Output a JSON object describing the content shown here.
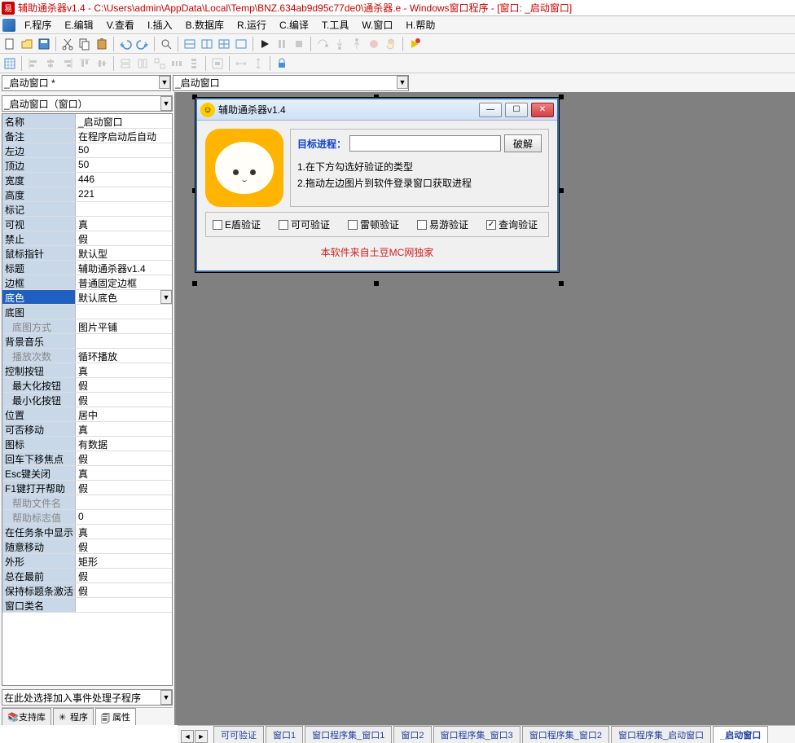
{
  "title": "辅助通杀器v1.4 - C:\\Users\\admin\\AppData\\Local\\Temp\\BNZ.634ab9d95c77de0\\通杀器.e - Windows窗口程序 - [窗口: _启动窗口]",
  "menu": {
    "program": "F.程序",
    "edit": "E.编辑",
    "view": "V.查看",
    "insert": "I.插入",
    "database": "B.数据库",
    "run": "R.运行",
    "compile": "C.编译",
    "tools": "T.工具",
    "window": "W.窗口",
    "help": "H.帮助"
  },
  "combo1": "_启动窗口 *",
  "combo2": "_启动窗口",
  "prop_combo": "_启动窗口（窗口）",
  "event_combo": "在此处选择加入事件处理子程序",
  "props": [
    {
      "k": "名称",
      "v": "_启动窗口"
    },
    {
      "k": "备注",
      "v": "在程序启动后自动"
    },
    {
      "k": "左边",
      "v": "50"
    },
    {
      "k": "顶边",
      "v": "50"
    },
    {
      "k": "宽度",
      "v": "446"
    },
    {
      "k": "高度",
      "v": "221"
    },
    {
      "k": "标记",
      "v": ""
    },
    {
      "k": "可视",
      "v": "真"
    },
    {
      "k": "禁止",
      "v": "假"
    },
    {
      "k": "鼠标指针",
      "v": "默认型"
    },
    {
      "k": "标题",
      "v": "辅助通杀器v1.4"
    },
    {
      "k": "边框",
      "v": "普通固定边框"
    },
    {
      "k": "底色",
      "v": "默认底色",
      "selected": true
    },
    {
      "k": "底图",
      "v": ""
    },
    {
      "k": "底图方式",
      "v": "图片平铺",
      "dim": true,
      "indent": true
    },
    {
      "k": "背景音乐",
      "v": ""
    },
    {
      "k": "播放次数",
      "v": "循环播放",
      "dim": true,
      "indent": true
    },
    {
      "k": "控制按钮",
      "v": "真"
    },
    {
      "k": "最大化按钮",
      "v": "假",
      "indent": true
    },
    {
      "k": "最小化按钮",
      "v": "假",
      "indent": true
    },
    {
      "k": "位置",
      "v": "居中"
    },
    {
      "k": "可否移动",
      "v": "真"
    },
    {
      "k": "图标",
      "v": "有数据"
    },
    {
      "k": "回车下移焦点",
      "v": "假"
    },
    {
      "k": "Esc键关闭",
      "v": "真"
    },
    {
      "k": "F1键打开帮助",
      "v": "假"
    },
    {
      "k": "帮助文件名",
      "v": "",
      "dim": true,
      "indent": true
    },
    {
      "k": "帮助标志值",
      "v": "0",
      "dim": true,
      "indent": true
    },
    {
      "k": "在任务条中显示",
      "v": "真"
    },
    {
      "k": "随意移动",
      "v": "假"
    },
    {
      "k": "外形",
      "v": "矩形"
    },
    {
      "k": "总在最前",
      "v": "假"
    },
    {
      "k": "保持标题条激活",
      "v": "假"
    },
    {
      "k": "窗口类名",
      "v": ""
    }
  ],
  "lefttabs": {
    "support": "支持库",
    "program": "程序",
    "property": "属性"
  },
  "designer": {
    "title": "辅助通杀器v1.4",
    "target_label": "目标进程：",
    "crack": "破解",
    "instr1": "1.在下方勾选好验证的类型",
    "instr2": "2.拖动左边图片到软件登录窗口获取进程",
    "checks": [
      {
        "label": "E盾验证",
        "checked": false
      },
      {
        "label": "可可验证",
        "checked": false
      },
      {
        "label": "雷顿验证",
        "checked": false
      },
      {
        "label": "易游验证",
        "checked": false
      },
      {
        "label": "查询验证",
        "checked": true
      }
    ],
    "footer": "本软件来自土豆MC网独家"
  },
  "bottomtabs": [
    "可可验证",
    "窗口1",
    "窗口程序集_窗口1",
    "窗口2",
    "窗口程序集_窗口3",
    "窗口程序集_窗口2",
    "窗口程序集_启动窗口",
    "_启动窗口"
  ]
}
